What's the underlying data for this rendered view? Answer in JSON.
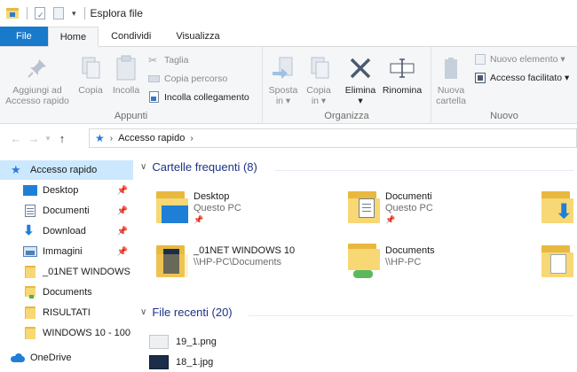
{
  "window": {
    "title": "Esplora file"
  },
  "tabs": [
    {
      "label": "File"
    },
    {
      "label": "Home"
    },
    {
      "label": "Condividi"
    },
    {
      "label": "Visualizza"
    }
  ],
  "ribbon": {
    "appunti": {
      "label": "Appunti",
      "pin": {
        "line1": "Aggiungi ad",
        "line2": "Accesso rapido"
      },
      "copy": "Copia",
      "paste": "Incolla",
      "cut": "Taglia",
      "copy_path": "Copia percorso",
      "paste_link": "Incolla collegamento"
    },
    "organizza": {
      "label": "Organizza",
      "move": {
        "line1": "Sposta",
        "line2": "in ▾"
      },
      "copyto": {
        "line1": "Copia",
        "line2": "in ▾"
      },
      "delete": {
        "line1": "Elimina",
        "line2": "▾"
      },
      "rename": "Rinomina"
    },
    "nuovo": {
      "label": "Nuovo",
      "new_folder": {
        "line1": "Nuova",
        "line2": "cartella"
      },
      "new_item": "Nuovo elemento ▾",
      "easy_access": "Accesso facilitato ▾"
    }
  },
  "address": {
    "location": "Accesso rapido"
  },
  "sidebar": {
    "items": [
      {
        "label": "Accesso rapido"
      },
      {
        "label": "Desktop",
        "pinned": "📌"
      },
      {
        "label": "Documenti",
        "pinned": "📌"
      },
      {
        "label": "Download",
        "pinned": "📌"
      },
      {
        "label": "Immagini",
        "pinned": "📌"
      },
      {
        "label": "_01NET WINDOWS"
      },
      {
        "label": "Documents"
      },
      {
        "label": "RISULTATI"
      },
      {
        "label": "WINDOWS 10 - 100"
      },
      {
        "label": "OneDrive"
      }
    ]
  },
  "main": {
    "frequent": {
      "heading": "Cartelle frequenti (8)",
      "tiles": [
        {
          "name": "Desktop",
          "location": "Questo PC"
        },
        {
          "name": "Documenti",
          "location": "Questo PC"
        },
        {
          "name": "_01NET WINDOWS 10",
          "location": "\\\\HP-PC\\Documents"
        },
        {
          "name": "Documents",
          "location": "\\\\HP-PC"
        }
      ]
    },
    "recent": {
      "heading": "File recenti (20)",
      "files": [
        {
          "name": "19_1.png"
        },
        {
          "name": "18_1.jpg"
        }
      ]
    }
  },
  "colors": {
    "accent": "#1979ca",
    "selection": "#cce8ff",
    "folder": "#f8d775",
    "heading": "#1e3287"
  }
}
